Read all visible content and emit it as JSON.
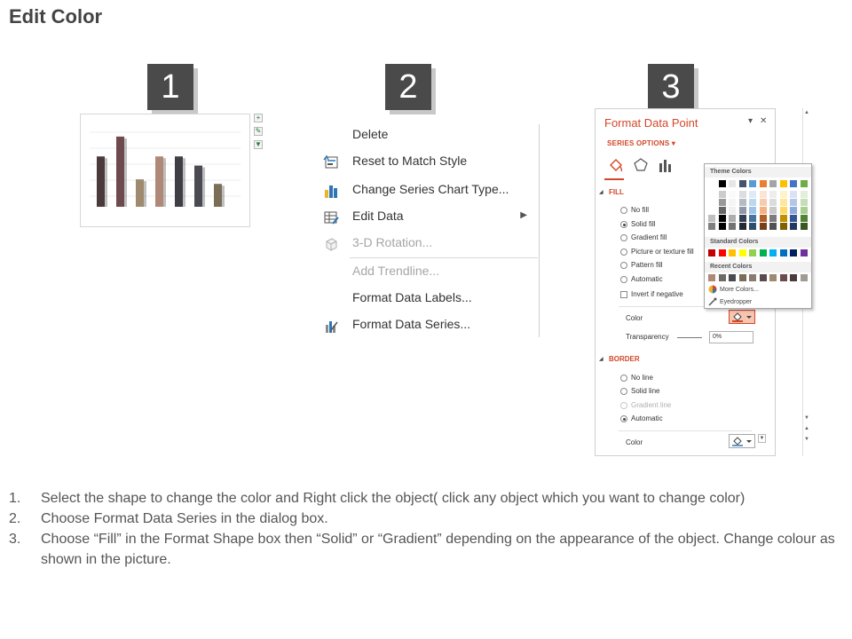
{
  "title": "Edit Color",
  "steps": [
    "1",
    "2",
    "3"
  ],
  "chart_thumb": {
    "bars": [
      {
        "value": 0.66,
        "color": "#4a3a3c"
      },
      {
        "value": 0.92,
        "color": "#6e4a4e"
      },
      {
        "value": 0.36,
        "color": "#9e8a6e"
      },
      {
        "value": 0.66,
        "color": "#b08878"
      },
      {
        "value": 0.66,
        "color": "#3e3e44"
      },
      {
        "value": 0.54,
        "color": "#4a4a52"
      },
      {
        "value": 0.3,
        "color": "#7a6e58"
      }
    ],
    "side_buttons": [
      "+",
      "✎",
      "▼"
    ]
  },
  "context_menu": {
    "items": [
      {
        "label": "Delete",
        "icon": "",
        "enabled": true,
        "submenu": false
      },
      {
        "label": "Reset to Match Style",
        "icon": "reset-style-icon",
        "enabled": true,
        "submenu": false
      },
      {
        "label": "Change Series Chart Type...",
        "icon": "bar-chart-icon",
        "enabled": true,
        "submenu": false
      },
      {
        "label": "Edit Data",
        "icon": "table-edit-icon",
        "enabled": true,
        "submenu": true
      },
      {
        "label": "3-D Rotation...",
        "icon": "cube-icon",
        "enabled": false,
        "submenu": false
      },
      {
        "label": "Add Trendline...",
        "icon": "",
        "enabled": false,
        "submenu": false
      },
      {
        "label": "Format Data Labels...",
        "icon": "",
        "enabled": true,
        "submenu": false
      },
      {
        "label": "Format Data Series...",
        "icon": "format-series-icon",
        "enabled": true,
        "submenu": false
      }
    ]
  },
  "format_pane": {
    "title": "Format Data Point",
    "series_options": "SERIES OPTIONS",
    "fill": {
      "heading": "FILL",
      "options": [
        {
          "label": "No fill",
          "selected": false
        },
        {
          "label": "Solid fill",
          "selected": true
        },
        {
          "label": "Gradient fill",
          "selected": false
        },
        {
          "label": "Picture or texture fill",
          "selected": false
        },
        {
          "label": "Pattern fill",
          "selected": false
        },
        {
          "label": "Automatic",
          "selected": false
        }
      ],
      "invert_label": "Invert if negative",
      "color_label": "Color",
      "transparency_label": "Transparency",
      "transparency_value": "0%"
    },
    "border": {
      "heading": "BORDER",
      "options": [
        {
          "label": "No line",
          "selected": false,
          "enabled": true
        },
        {
          "label": "Solid line",
          "selected": false,
          "enabled": true
        },
        {
          "label": "Gradient line",
          "selected": false,
          "enabled": false
        },
        {
          "label": "Automatic",
          "selected": true,
          "enabled": true
        }
      ],
      "color_label": "Color"
    },
    "accent": "#d2472a"
  },
  "color_popup": {
    "theme_label": "Theme Colors",
    "standard_label": "Standard Colors",
    "recent_label": "Recent Colors",
    "more_colors": "More Colors...",
    "eyedropper": "Eyedropper",
    "theme_top": [
      "#ffffff",
      "#000000",
      "#e7e6e6",
      "#44546a",
      "#5b9bd5",
      "#ed7d31",
      "#a5a5a5",
      "#ffc000",
      "#4472c4",
      "#70ad47"
    ],
    "standard": [
      "#c00000",
      "#ff0000",
      "#ffc000",
      "#ffff00",
      "#92d050",
      "#00b050",
      "#00b0f0",
      "#0070c0",
      "#002060",
      "#7030a0"
    ],
    "recent": [
      "#b08878",
      "#6e6a64",
      "#4a4a52",
      "#7a6e58",
      "#8a7a70",
      "#5a4a4e",
      "#9e8a6e",
      "#6e4a4e",
      "#4a3a3c",
      "#a09a94"
    ]
  },
  "instructions": [
    {
      "num": "1.",
      "text": "Select the shape to change the color and Right click the object( click any object which you want to change color)"
    },
    {
      "num": "2.",
      "text": "Choose Format Data Series in the dialog box."
    },
    {
      "num": "3.",
      "text": "Choose “Fill” in the Format Shape box then “Solid” or “Gradient” depending on the appearance of the object. Change colour as shown in the picture."
    }
  ]
}
